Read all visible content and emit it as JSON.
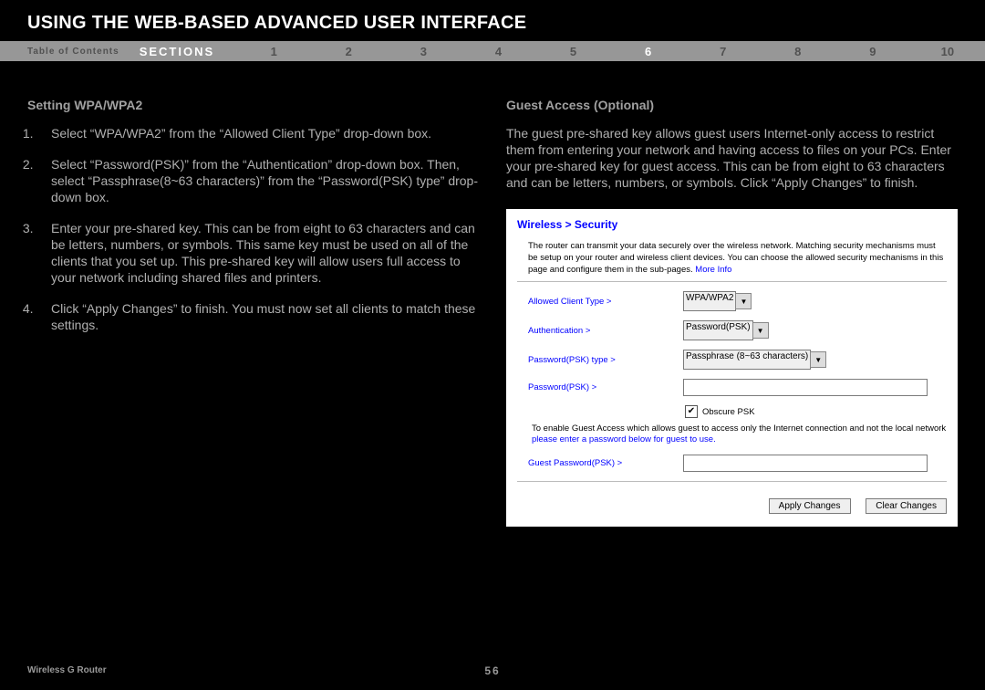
{
  "header": {
    "title": "USING THE WEB-BASED ADVANCED USER INTERFACE"
  },
  "nav": {
    "toc_label": "Table of Contents",
    "sections_label": "SECTIONS",
    "items": [
      "1",
      "2",
      "3",
      "4",
      "5",
      "6",
      "7",
      "8",
      "9",
      "10"
    ],
    "active_index": 5
  },
  "left": {
    "heading": "Setting WPA/WPA2",
    "steps": [
      "Select “WPA/WPA2” from the “Allowed Client Type” drop-down box.",
      "Select “Password(PSK)” from the “Authentication” drop-down box. Then, select “Passphrase(8~63 characters)” from the “Password(PSK) type” drop-down box.",
      "Enter your pre-shared key. This can be from eight to 63 characters and can be letters, numbers, or symbols. This same key must be used on all of the clients that you set up. This pre-shared key will allow users full access to your network including shared files and printers.",
      "Click “Apply Changes” to finish. You must now set all clients to match these settings."
    ]
  },
  "right": {
    "heading": "Guest Access (Optional)",
    "body": "The guest pre-shared key allows guest users Internet-only access to restrict them from entering your network and having access to files on your PCs. Enter your pre-shared key for guest access. This can be from eight to 63 characters and can be letters, numbers, or symbols. Click “Apply Changes” to finish."
  },
  "router": {
    "breadcrumb": "Wireless > Security",
    "intro": "The router can transmit your data securely over the wireless network. Matching security mechanisms must be setup on your router and wireless client devices. You can choose the allowed security mechanisms in this page and configure them in the sub-pages.",
    "more_info": "More Info",
    "fields": {
      "allowed_label": "Allowed Client Type >",
      "allowed_value": "WPA/WPA2",
      "auth_label": "Authentication >",
      "auth_value": "Password(PSK)",
      "psk_type_label": "Password(PSK) type >",
      "psk_type_value": "Passphrase (8~63 characters)",
      "psk_label": "Password(PSK) >",
      "psk_value": "",
      "obscure_label": "Obscure PSK",
      "obscure_checked": true,
      "guest_note_black": "To enable Guest Access which allows guest to access only the Internet connection and not the local network",
      "guest_note_blue": "please enter a password below for guest to use.",
      "guest_psk_label": "Guest Password(PSK) >",
      "guest_psk_value": ""
    },
    "buttons": {
      "apply": "Apply Changes",
      "clear": "Clear Changes"
    }
  },
  "footer": {
    "product": "Wireless G Router",
    "page": "56"
  }
}
